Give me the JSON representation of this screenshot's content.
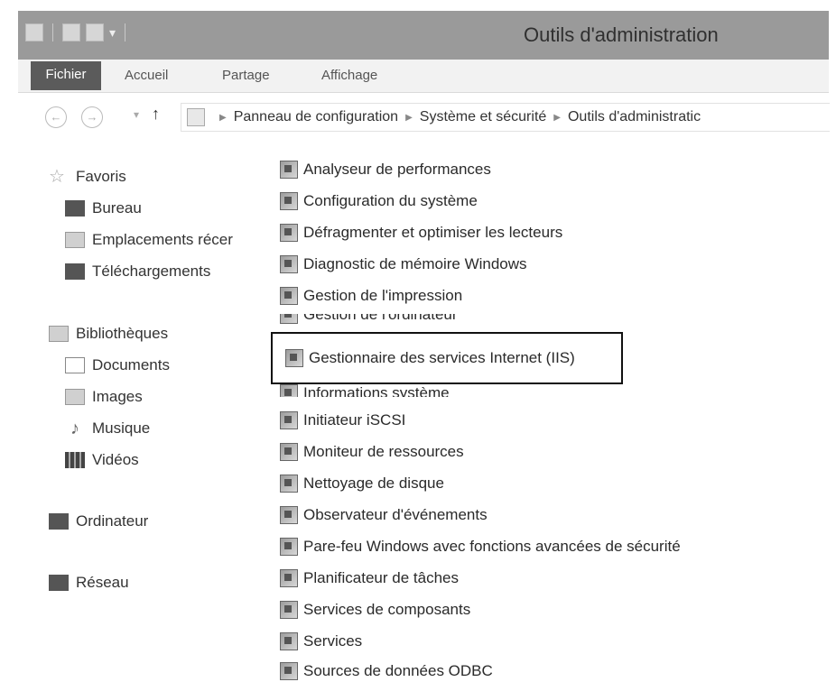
{
  "window": {
    "title": "Outils d'administration"
  },
  "ribbon": {
    "tabs": [
      "Fichier",
      "Accueil",
      "Partage",
      "Affichage"
    ]
  },
  "nav": {
    "back_icon": "back-arrow-icon",
    "forward_icon": "forward-arrow-icon",
    "up_icon": "up-arrow-icon",
    "breadcrumb": [
      "Panneau de configuration",
      "Système et sécurité",
      "Outils d'administratic"
    ]
  },
  "sidebar": {
    "favorites": {
      "label": "Favoris",
      "items": [
        "Bureau",
        "Emplacements récer",
        "Téléchargements"
      ]
    },
    "libraries": {
      "label": "Bibliothèques",
      "items": [
        "Documents",
        "Images",
        "Musique",
        "Vidéos"
      ]
    },
    "computer": "Ordinateur",
    "network": "Réseau"
  },
  "tools": [
    "Analyseur de performances",
    "Configuration du système",
    "Défragmenter et optimiser les lecteurs",
    "Diagnostic de mémoire Windows",
    "Gestion de l'impression",
    "Gestion de l'ordinateur",
    "Gestionnaire des services Internet (IIS)",
    "Informations système",
    "Initiateur iSCSI",
    "Moniteur de ressources",
    "Nettoyage de disque",
    "Observateur d'événements",
    "Pare-feu Windows avec fonctions avancées de sécurité",
    "Planificateur de tâches",
    "Services de composants",
    "Services",
    "Sources de données ODBC"
  ],
  "colors": {
    "titlebar": "#9a9a9a",
    "file_tab": "#5b5b5b",
    "highlight_border": "#111111"
  }
}
